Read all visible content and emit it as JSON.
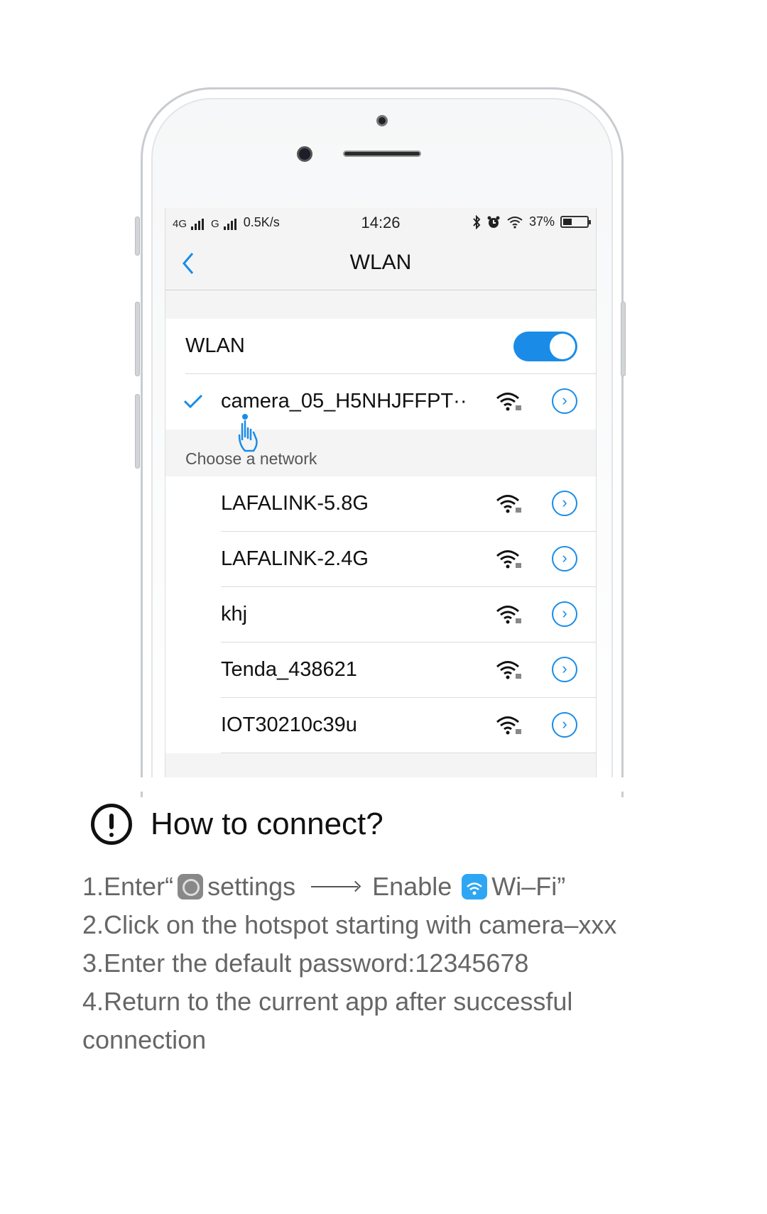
{
  "statusbar": {
    "network1": "4G",
    "network2": "G",
    "speed": "0.5K/s",
    "time": "14:26",
    "battery_percent": "37%",
    "battery_level": 0.37
  },
  "navbar": {
    "title": "WLAN",
    "back_icon": "chevron-left-icon"
  },
  "wlan": {
    "label": "WLAN",
    "enabled": true,
    "connected_network": "camera_05_H5NHJFFPT··"
  },
  "section": {
    "choose_label": "Choose a network"
  },
  "networks": [
    {
      "name": "LAFALINK-5.8G"
    },
    {
      "name": "LAFALINK-2.4G"
    },
    {
      "name": "khj"
    },
    {
      "name": "Tenda_438621"
    },
    {
      "name": "IOT30210c39u"
    }
  ],
  "instructions": {
    "title": "How to connect?",
    "step1_prefix": "1.Enter“",
    "step1_settings": "settings",
    "step1_enable": "Enable",
    "step1_wifi": "Wi–Fi”",
    "step2": "2.Click on the hotspot starting with camera–xxx",
    "step3": "3.Enter the default password:12345678",
    "step4a": "4.Return to the current app after successful",
    "step4b": "connection"
  },
  "colors": {
    "accent": "#1a8ce8",
    "text": "#111111",
    "muted": "#666666"
  }
}
